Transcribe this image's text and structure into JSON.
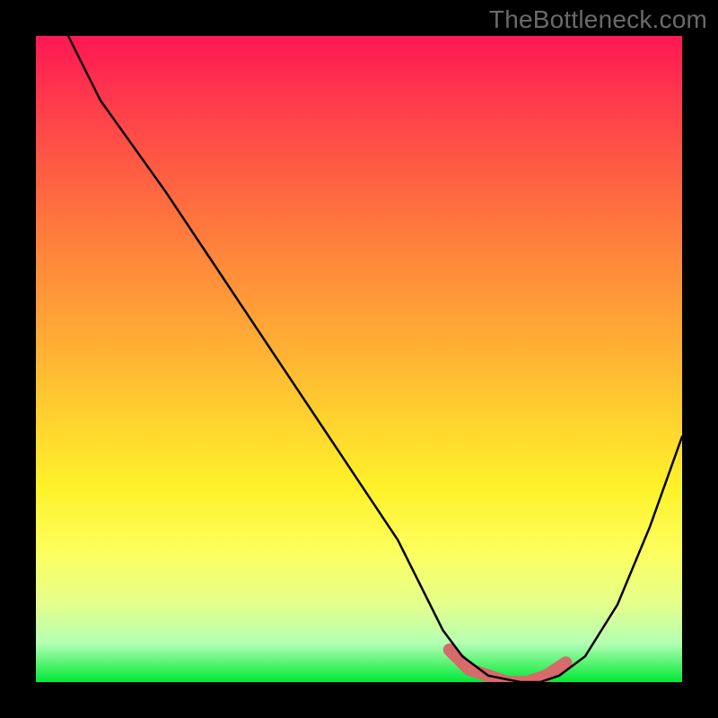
{
  "watermark": "TheBottleneck.com",
  "colors": {
    "frame": "#000000",
    "watermark_text": "#6a6a6a",
    "curve": "#000000",
    "trough_marker": "#d76a6a",
    "gradient_top": "#ff1753",
    "gradient_bottom": "#00e836"
  },
  "chart_data": {
    "type": "line",
    "title": "",
    "xlabel": "",
    "ylabel": "",
    "xlim": [
      0,
      100
    ],
    "ylim": [
      0,
      100
    ],
    "grid": false,
    "legend": false,
    "series": [
      {
        "name": "bottleneck-curve",
        "x": [
          5,
          10,
          20,
          30,
          40,
          50,
          56,
          60,
          63,
          66,
          70,
          75,
          78,
          81,
          85,
          90,
          95,
          100
        ],
        "y": [
          100,
          90,
          76,
          61,
          46,
          31,
          22,
          14,
          8,
          4,
          1,
          0,
          0,
          1,
          4,
          12,
          24,
          38
        ]
      }
    ],
    "highlight": {
      "name": "trough",
      "x": [
        64,
        67,
        70,
        73,
        76,
        79,
        82
      ],
      "y": [
        5,
        2,
        1,
        0,
        0,
        1,
        3
      ]
    }
  }
}
